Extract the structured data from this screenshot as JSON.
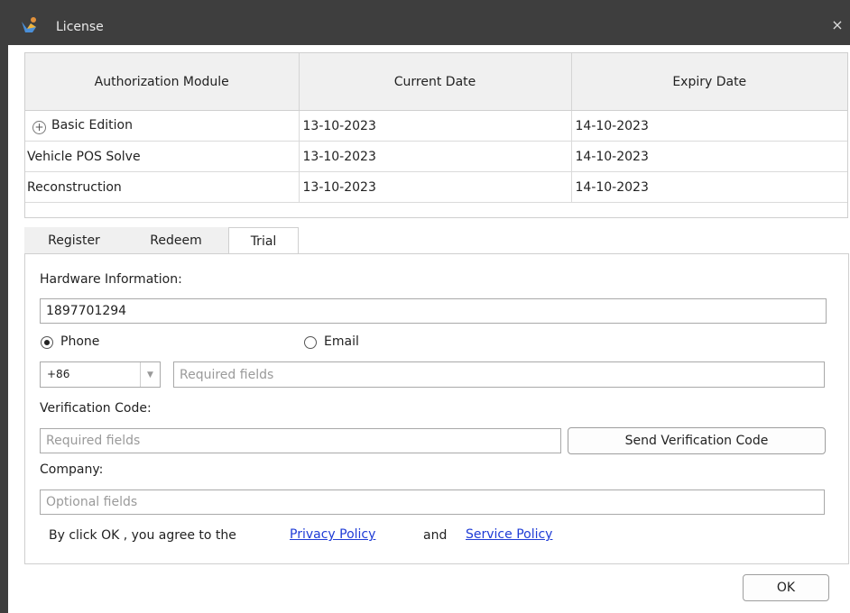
{
  "window": {
    "title": "License",
    "close_glyph": "×"
  },
  "table": {
    "headers": [
      "Authorization Module",
      "Current Date",
      "Expiry Date"
    ],
    "rows": [
      {
        "module": "Basic Edition",
        "current": "13-10-2023",
        "expiry": "14-10-2023",
        "expandable": true
      },
      {
        "module": "Vehicle POS Solve",
        "current": "13-10-2023",
        "expiry": "14-10-2023",
        "expandable": false
      },
      {
        "module": "Reconstruction",
        "current": "13-10-2023",
        "expiry": "14-10-2023",
        "expandable": false
      }
    ]
  },
  "tabs": {
    "register": "Register",
    "redeem": "Redeem",
    "trial": "Trial",
    "active": "Trial"
  },
  "form": {
    "hardware_label": "Hardware Information:",
    "hardware_value": "1897701294",
    "phone_label": "Phone",
    "email_label": "Email",
    "contact_selected": "Phone",
    "country_code": "+86",
    "phone_placeholder": "Required fields",
    "verification_label": "Verification Code:",
    "verification_placeholder": "Required fields",
    "send_code_button": "Send Verification Code",
    "company_label": "Company:",
    "company_placeholder": "Optional fields",
    "agree_text": "By click OK , you agree to the",
    "privacy_link": "Privacy Policy",
    "and_text": "and",
    "service_link": "Service Policy"
  },
  "footer": {
    "ok_button": "OK"
  },
  "icons": {
    "app": "app-logo-icon",
    "close": "close-icon",
    "expand": "expand-plus-icon",
    "dropdown": "dropdown-arrow-icon"
  },
  "colors": {
    "titlebar": "#3e3e3e",
    "link": "#1f3cd6",
    "header_bg": "#f0f0f0"
  }
}
